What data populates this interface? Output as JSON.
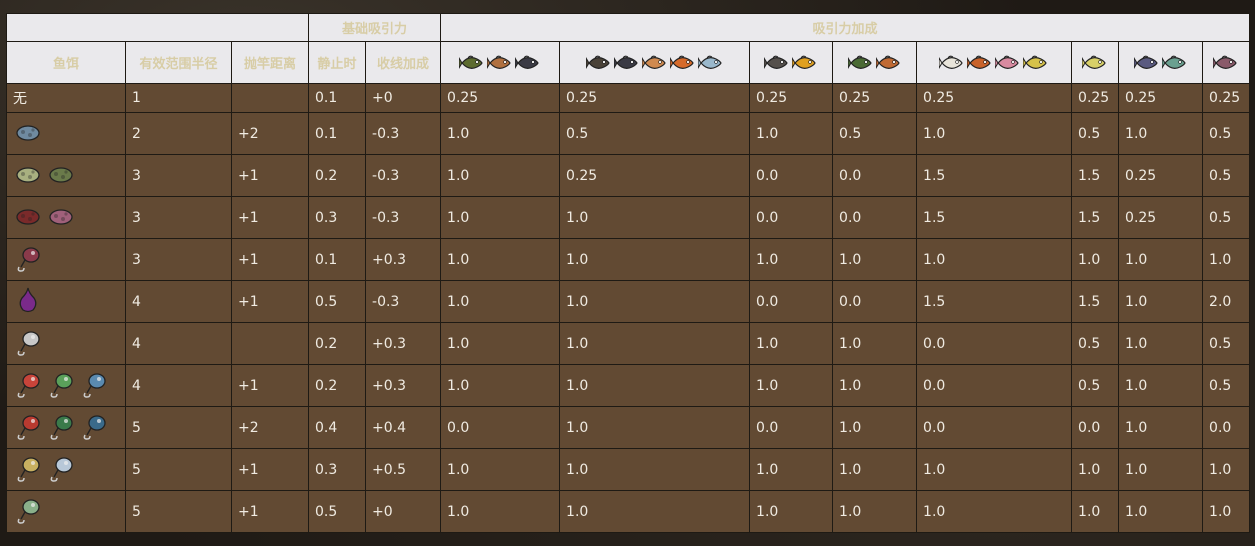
{
  "header": {
    "group_base": "基础吸引力",
    "group_bonus": "吸引力加成",
    "col_bait": "鱼饵",
    "col_range": "有效范围半径",
    "col_cast": "抛竿距离",
    "col_static": "静止时",
    "col_reel": "收线加成"
  },
  "fish_groups": [
    {
      "name": "fish-group-1",
      "icons": [
        "green-fish-icon",
        "orange-fish-icon",
        "dark-fish-icon"
      ],
      "colors": [
        "#5c6b2e",
        "#b07040",
        "#3a3a44"
      ]
    },
    {
      "name": "fish-group-2",
      "icons": [
        "spiky-fish-icon",
        "dark-fish-icon",
        "orange-fish-icon",
        "orange-fish-icon",
        "blue-fish-icon"
      ],
      "colors": [
        "#4a4238",
        "#3a3a44",
        "#d08a50",
        "#d66a2a",
        "#9ab8cc"
      ]
    },
    {
      "name": "fish-group-3",
      "icons": [
        "grey-fish-icon",
        "sun-fish-icon"
      ],
      "colors": [
        "#55504c",
        "#e0a020"
      ]
    },
    {
      "name": "fish-group-4",
      "icons": [
        "green-fish-icon",
        "orange-fish-icon"
      ],
      "colors": [
        "#4a6a34",
        "#c06a34"
      ]
    },
    {
      "name": "fish-group-5",
      "icons": [
        "white-fish-icon",
        "orange-fish-icon",
        "pink-fish-icon",
        "yellow-fish-icon"
      ],
      "colors": [
        "#e8e4da",
        "#c8622a",
        "#d88aa0",
        "#d6c24a"
      ]
    },
    {
      "name": "fish-group-6",
      "icons": [
        "yellow-fish-icon"
      ],
      "colors": [
        "#d8d068"
      ]
    },
    {
      "name": "fish-group-7",
      "icons": [
        "blue-fish-icon",
        "teal-fish-icon"
      ],
      "colors": [
        "#5a5a80",
        "#6aa090"
      ]
    },
    {
      "name": "fish-group-8",
      "icons": [
        "purple-fish-icon"
      ],
      "colors": [
        "#8a5a6a"
      ]
    }
  ],
  "rows": [
    {
      "bait_text": "无",
      "bait_icons": [],
      "range": "1",
      "cast": "",
      "static": "0.1",
      "reel": "+0",
      "bonus": [
        "0.25",
        "0.25",
        "0.25",
        "0.25",
        "0.25",
        "0.25",
        "0.25",
        "0.25"
      ]
    },
    {
      "bait_text": "",
      "bait_icons": [
        {
          "name": "leaf-bait-icon",
          "color": "#6f8aa0"
        }
      ],
      "range": "2",
      "cast": "+2",
      "static": "0.1",
      "reel": "-0.3",
      "bonus": [
        "1.0",
        "0.5",
        "1.0",
        "0.5",
        "1.0",
        "0.5",
        "1.0",
        "0.5"
      ]
    },
    {
      "bait_text": "",
      "bait_icons": [
        {
          "name": "seed-bait-icon",
          "color": "#a8b080"
        },
        {
          "name": "seeds-pile-icon",
          "color": "#6a7a4a"
        }
      ],
      "range": "3",
      "cast": "+1",
      "static": "0.2",
      "reel": "-0.3",
      "bonus": [
        "1.0",
        "0.25",
        "0.0",
        "0.0",
        "1.5",
        "1.5",
        "0.25",
        "0.5"
      ]
    },
    {
      "bait_text": "",
      "bait_icons": [
        {
          "name": "berries-bait-icon",
          "color": "#7a2a2a"
        },
        {
          "name": "berry-cluster-icon",
          "color": "#a0607a"
        }
      ],
      "range": "3",
      "cast": "+1",
      "static": "0.3",
      "reel": "-0.3",
      "bonus": [
        "1.0",
        "1.0",
        "0.0",
        "0.0",
        "1.5",
        "1.5",
        "0.25",
        "0.5"
      ]
    },
    {
      "bait_text": "",
      "bait_icons": [
        {
          "name": "hook-bait-icon",
          "color": "#8a3a4a"
        }
      ],
      "range": "3",
      "cast": "+1",
      "static": "0.1",
      "reel": "+0.3",
      "bonus": [
        "1.0",
        "1.0",
        "1.0",
        "1.0",
        "1.0",
        "1.0",
        "1.0",
        "1.0"
      ]
    },
    {
      "bait_text": "",
      "bait_icons": [
        {
          "name": "onion-bait-icon",
          "color": "#7a2a8a"
        }
      ],
      "range": "4",
      "cast": "+1",
      "static": "0.5",
      "reel": "-0.3",
      "bonus": [
        "1.0",
        "1.0",
        "0.0",
        "0.0",
        "1.5",
        "1.5",
        "1.0",
        "2.0"
      ]
    },
    {
      "bait_text": "",
      "bait_icons": [
        {
          "name": "spoon-lure-icon",
          "color": "#c8c8c8"
        }
      ],
      "range": "4",
      "cast": "",
      "static": "0.2",
      "reel": "+0.3",
      "bonus": [
        "1.0",
        "1.0",
        "1.0",
        "1.0",
        "0.0",
        "0.5",
        "1.0",
        "0.5"
      ]
    },
    {
      "bait_text": "",
      "bait_icons": [
        {
          "name": "red-spinner-lure-icon",
          "color": "#c8443a"
        },
        {
          "name": "green-spinner-lure-icon",
          "color": "#5aa05a"
        },
        {
          "name": "blue-spinner-lure-icon",
          "color": "#5a8ab0"
        }
      ],
      "range": "4",
      "cast": "+1",
      "static": "0.2",
      "reel": "+0.3",
      "bonus": [
        "1.0",
        "1.0",
        "1.0",
        "1.0",
        "0.0",
        "0.5",
        "1.0",
        "0.5"
      ]
    },
    {
      "bait_text": "",
      "bait_icons": [
        {
          "name": "red-ball-lure-icon",
          "color": "#b83a30"
        },
        {
          "name": "green-ball-lure-icon",
          "color": "#3a7a4a"
        },
        {
          "name": "blue-ball-lure-icon",
          "color": "#3a6a8a"
        }
      ],
      "range": "5",
      "cast": "+2",
      "static": "0.4",
      "reel": "+0.4",
      "bonus": [
        "0.0",
        "1.0",
        "0.0",
        "1.0",
        "0.0",
        "0.0",
        "1.0",
        "0.0"
      ]
    },
    {
      "bait_text": "",
      "bait_icons": [
        {
          "name": "flower-lure-icon",
          "color": "#c8b060"
        },
        {
          "name": "star-lure-icon",
          "color": "#b8c8d8"
        }
      ],
      "range": "5",
      "cast": "+1",
      "static": "0.3",
      "reel": "+0.5",
      "bonus": [
        "1.0",
        "1.0",
        "1.0",
        "1.0",
        "1.0",
        "1.0",
        "1.0",
        "1.0"
      ]
    },
    {
      "bait_text": "",
      "bait_icons": [
        {
          "name": "skull-lure-icon",
          "color": "#8ab08a"
        }
      ],
      "range": "5",
      "cast": "+1",
      "static": "0.5",
      "reel": "+0",
      "bonus": [
        "1.0",
        "1.0",
        "1.0",
        "1.0",
        "1.0",
        "1.0",
        "1.0",
        "1.0"
      ]
    }
  ]
}
